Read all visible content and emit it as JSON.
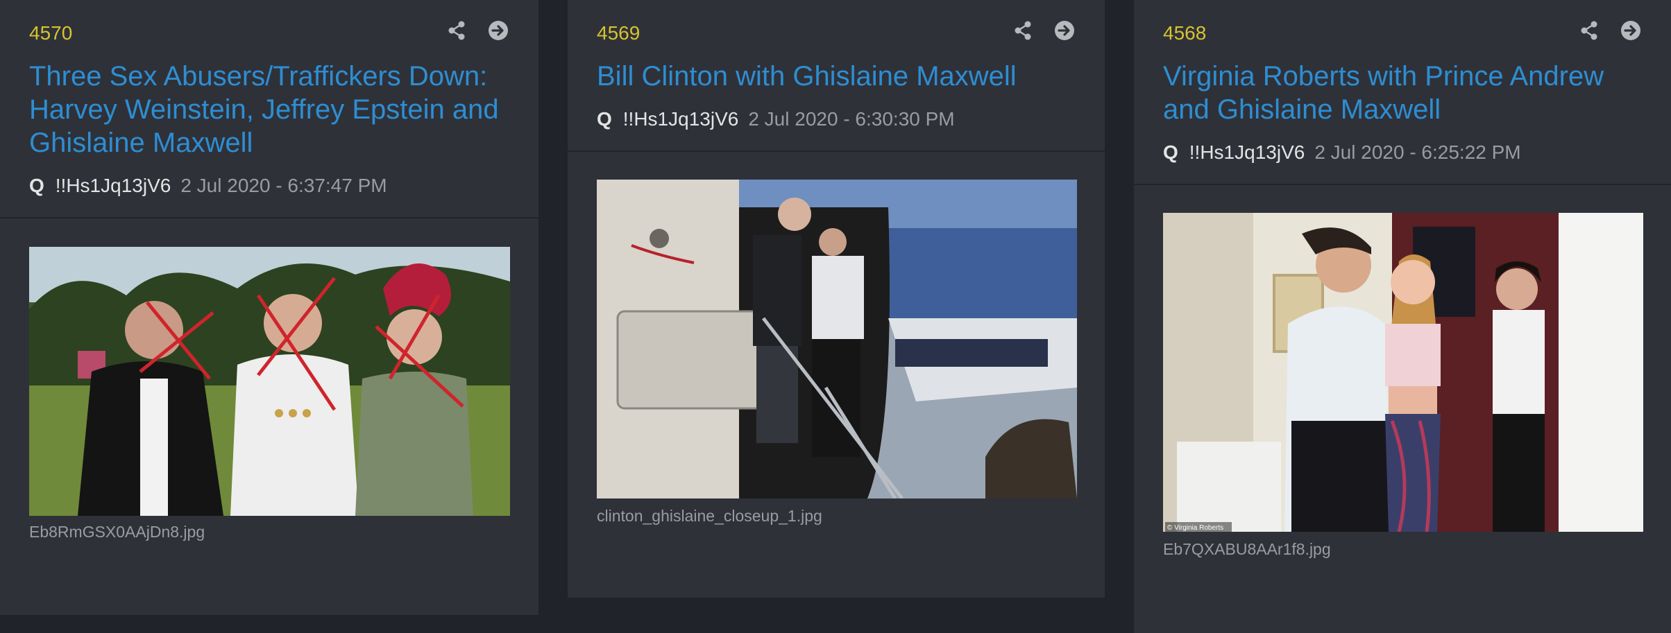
{
  "posts": [
    {
      "number": "4570",
      "title": "Three Sex Abusers/Traffickers Down: Harvey Weinstein, Jeffrey Epstein and Ghislaine Maxwell",
      "author": "Q",
      "tripcode": "!!Hs1Jq13jV6",
      "date": "2 Jul 2020 - 6:37:47 PM",
      "filename": "Eb8RmGSX0AAjDn8.jpg"
    },
    {
      "number": "4569",
      "title": "Bill Clinton with Ghislaine Maxwell",
      "author": "Q",
      "tripcode": "!!Hs1Jq13jV6",
      "date": "2 Jul 2020 - 6:30:30 PM",
      "filename": "clinton_ghislaine_closeup_1.jpg"
    },
    {
      "number": "4568",
      "title": "Virginia Roberts with Prince Andrew and Ghislaine Maxwell",
      "author": "Q",
      "tripcode": "!!Hs1Jq13jV6",
      "date": "2 Jul 2020 - 6:25:22 PM",
      "filename": "Eb7QXABU8AAr1f8.jpg",
      "watermark": "© Virginia Roberts"
    }
  ],
  "icons": {
    "share": "share-icon",
    "open": "arrow-right-circle-icon"
  },
  "colors": {
    "background": "#21232a",
    "card": "#2f3139",
    "number": "#d6c42f",
    "title": "#2d8ed2",
    "date": "#9b9ca2"
  }
}
